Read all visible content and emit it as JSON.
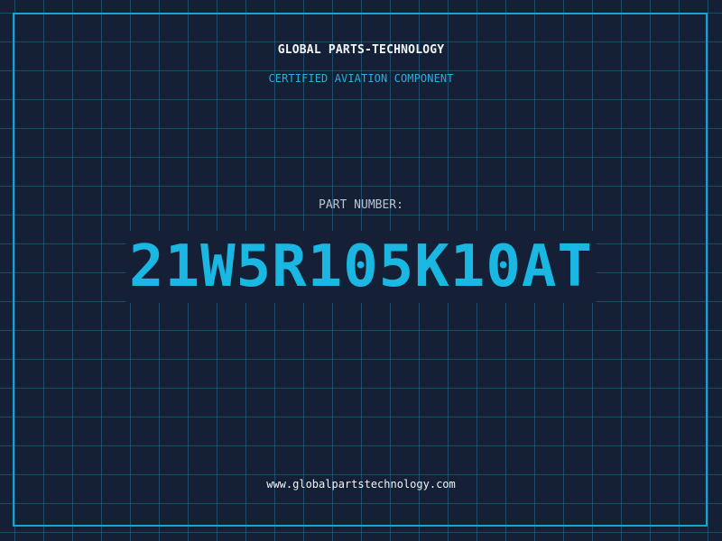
{
  "header": {
    "company": "GLOBAL PARTS-TECHNOLOGY",
    "tagline": "CERTIFIED AVIATION COMPONENT"
  },
  "part": {
    "label": "PART NUMBER:",
    "number": "21W5R105K10AT"
  },
  "footer": {
    "website": "www.globalpartstechnology.com"
  },
  "colors": {
    "background": "#152036",
    "grid": "#266f96",
    "accent": "#1ab7e3",
    "text": "#f2f5f8"
  }
}
